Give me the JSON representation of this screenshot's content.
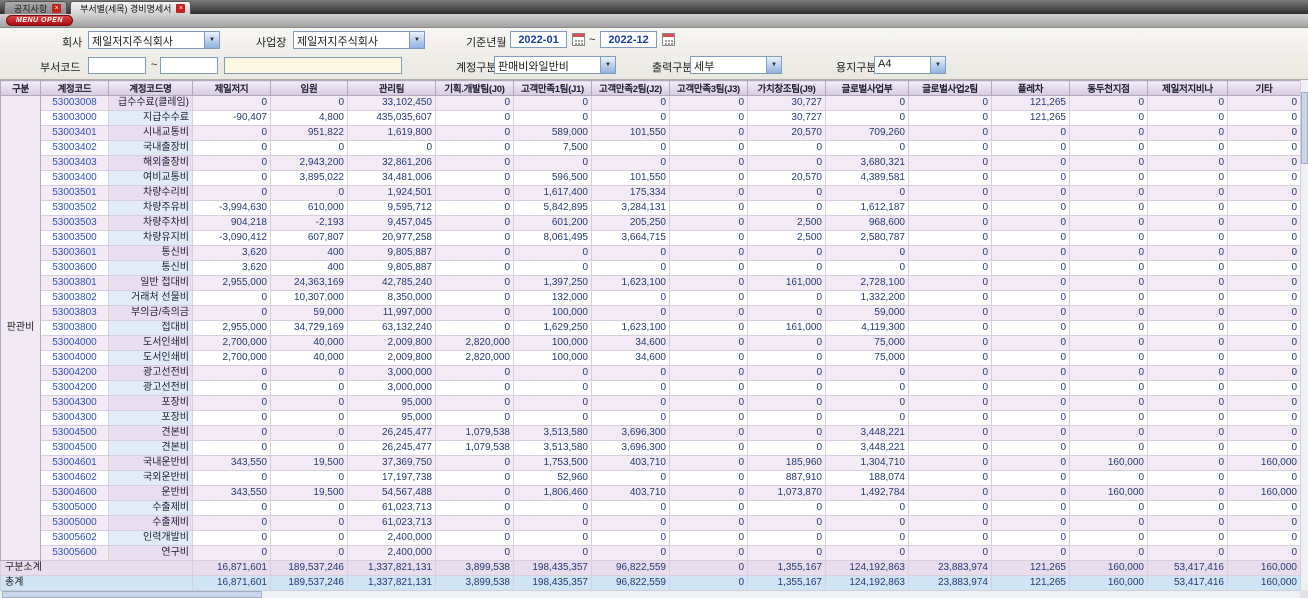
{
  "window": {
    "tabs": [
      {
        "label": "공지사항"
      },
      {
        "label": "부서별(세목) 경비명세서"
      }
    ],
    "menu_open_label": "MENU OPEN"
  },
  "filters": {
    "company_label": "회사",
    "company_value": "제일저지주식회사",
    "site_label": "사업장",
    "site_value": "제일저지주식회사",
    "period_label": "기준년월",
    "period_from": "2022-01",
    "period_to": "2022-12",
    "range_separator": "~",
    "dept_code_label": "부서코드",
    "dept_code_from": "",
    "dept_code_to": "",
    "dept_name": "",
    "account_type_label": "계정구분",
    "account_type_value": "판매비와일반비",
    "output_type_label": "출력구분",
    "output_type_value": "세부",
    "paper_type_label": "용지구분",
    "paper_type_value": "A4"
  },
  "table": {
    "group_label": "판관비",
    "headers": [
      "구분",
      "계정코드",
      "계정코드명",
      "제일저지",
      "임원",
      "관리팀",
      "기획.개발팀(J0)",
      "고객만족1팀(J1)",
      "고객만족2팀(J2)",
      "고객만족3팀(J3)",
      "가치창조팀(J9)",
      "글로벌사업부",
      "글로벌사업2팀",
      "플레차",
      "동두천지점",
      "제일저지비나",
      "기타"
    ],
    "rows": [
      {
        "code": "53003008",
        "name": "급수수료(클레임)",
        "values": [
          "0",
          "0",
          "33,102,450",
          "0",
          "0",
          "0",
          "0",
          "30,727",
          "0",
          "0",
          "121,265",
          "0",
          "0",
          "0"
        ]
      },
      {
        "code": "53003000",
        "name": "지급수수료",
        "values": [
          "-90,407",
          "4,800",
          "435,035,607",
          "0",
          "0",
          "0",
          "0",
          "30,727",
          "0",
          "0",
          "121,265",
          "0",
          "0",
          "0"
        ]
      },
      {
        "code": "53003401",
        "name": "시내교통비",
        "values": [
          "0",
          "951,822",
          "1,619,800",
          "0",
          "589,000",
          "101,550",
          "0",
          "20,570",
          "709,260",
          "0",
          "0",
          "0",
          "0",
          "0"
        ]
      },
      {
        "code": "53003402",
        "name": "국내출장비",
        "values": [
          "0",
          "0",
          "0",
          "0",
          "7,500",
          "0",
          "0",
          "0",
          "0",
          "0",
          "0",
          "0",
          "0",
          "0"
        ]
      },
      {
        "code": "53003403",
        "name": "해외출장비",
        "values": [
          "0",
          "2,943,200",
          "32,861,206",
          "0",
          "0",
          "0",
          "0",
          "0",
          "3,680,321",
          "0",
          "0",
          "0",
          "0",
          "0"
        ]
      },
      {
        "code": "53003400",
        "name": "여비교통비",
        "values": [
          "0",
          "3,895,022",
          "34,481,006",
          "0",
          "596,500",
          "101,550",
          "0",
          "20,570",
          "4,389,581",
          "0",
          "0",
          "0",
          "0",
          "0"
        ]
      },
      {
        "code": "53003501",
        "name": "차량수리비",
        "values": [
          "0",
          "0",
          "1,924,501",
          "0",
          "1,617,400",
          "175,334",
          "0",
          "0",
          "0",
          "0",
          "0",
          "0",
          "0",
          "0"
        ]
      },
      {
        "code": "53003502",
        "name": "차량주유비",
        "values": [
          "-3,994,630",
          "610,000",
          "9,595,712",
          "0",
          "5,842,895",
          "3,284,131",
          "0",
          "0",
          "1,612,187",
          "0",
          "0",
          "0",
          "0",
          "0"
        ]
      },
      {
        "code": "53003503",
        "name": "차량주차비",
        "values": [
          "904,218",
          "-2,193",
          "9,457,045",
          "0",
          "601,200",
          "205,250",
          "0",
          "2,500",
          "968,600",
          "0",
          "0",
          "0",
          "0",
          "0"
        ]
      },
      {
        "code": "53003500",
        "name": "차량유지비",
        "values": [
          "-3,090,412",
          "607,807",
          "20,977,258",
          "0",
          "8,061,495",
          "3,664,715",
          "0",
          "2,500",
          "2,580,787",
          "0",
          "0",
          "0",
          "0",
          "0"
        ]
      },
      {
        "code": "53003601",
        "name": "통신비",
        "values": [
          "3,620",
          "400",
          "9,805,887",
          "0",
          "0",
          "0",
          "0",
          "0",
          "0",
          "0",
          "0",
          "0",
          "0",
          "0"
        ]
      },
      {
        "code": "53003600",
        "name": "통신비",
        "values": [
          "3,620",
          "400",
          "9,805,887",
          "0",
          "0",
          "0",
          "0",
          "0",
          "0",
          "0",
          "0",
          "0",
          "0",
          "0"
        ]
      },
      {
        "code": "53003801",
        "name": "일반 접대비",
        "values": [
          "2,955,000",
          "24,363,169",
          "42,785,240",
          "0",
          "1,397,250",
          "1,623,100",
          "0",
          "161,000",
          "2,728,100",
          "0",
          "0",
          "0",
          "0",
          "0"
        ]
      },
      {
        "code": "53003802",
        "name": "거래처 선물비",
        "values": [
          "0",
          "10,307,000",
          "8,350,000",
          "0",
          "132,000",
          "0",
          "0",
          "0",
          "1,332,200",
          "0",
          "0",
          "0",
          "0",
          "0"
        ]
      },
      {
        "code": "53003803",
        "name": "부의금/축의금",
        "values": [
          "0",
          "59,000",
          "11,997,000",
          "0",
          "100,000",
          "0",
          "0",
          "0",
          "59,000",
          "0",
          "0",
          "0",
          "0",
          "0"
        ]
      },
      {
        "code": "53003800",
        "name": "접대비",
        "values": [
          "2,955,000",
          "34,729,169",
          "63,132,240",
          "0",
          "1,629,250",
          "1,623,100",
          "0",
          "161,000",
          "4,119,300",
          "0",
          "0",
          "0",
          "0",
          "0"
        ]
      },
      {
        "code": "53004000",
        "name": "도서인쇄비",
        "values": [
          "2,700,000",
          "40,000",
          "2,009,800",
          "2,820,000",
          "100,000",
          "34,600",
          "0",
          "0",
          "75,000",
          "0",
          "0",
          "0",
          "0",
          "0"
        ]
      },
      {
        "code": "53004000",
        "name": "도서인쇄비",
        "values": [
          "2,700,000",
          "40,000",
          "2,009,800",
          "2,820,000",
          "100,000",
          "34,600",
          "0",
          "0",
          "75,000",
          "0",
          "0",
          "0",
          "0",
          "0"
        ]
      },
      {
        "code": "53004200",
        "name": "광고선전비",
        "values": [
          "0",
          "0",
          "3,000,000",
          "0",
          "0",
          "0",
          "0",
          "0",
          "0",
          "0",
          "0",
          "0",
          "0",
          "0"
        ]
      },
      {
        "code": "53004200",
        "name": "광고선전비",
        "values": [
          "0",
          "0",
          "3,000,000",
          "0",
          "0",
          "0",
          "0",
          "0",
          "0",
          "0",
          "0",
          "0",
          "0",
          "0"
        ]
      },
      {
        "code": "53004300",
        "name": "포장비",
        "values": [
          "0",
          "0",
          "95,000",
          "0",
          "0",
          "0",
          "0",
          "0",
          "0",
          "0",
          "0",
          "0",
          "0",
          "0"
        ]
      },
      {
        "code": "53004300",
        "name": "포장비",
        "values": [
          "0",
          "0",
          "95,000",
          "0",
          "0",
          "0",
          "0",
          "0",
          "0",
          "0",
          "0",
          "0",
          "0",
          "0"
        ]
      },
      {
        "code": "53004500",
        "name": "견본비",
        "values": [
          "0",
          "0",
          "26,245,477",
          "1,079,538",
          "3,513,580",
          "3,696,300",
          "0",
          "0",
          "3,448,221",
          "0",
          "0",
          "0",
          "0",
          "0"
        ]
      },
      {
        "code": "53004500",
        "name": "견본비",
        "values": [
          "0",
          "0",
          "26,245,477",
          "1,079,538",
          "3,513,580",
          "3,696,300",
          "0",
          "0",
          "3,448,221",
          "0",
          "0",
          "0",
          "0",
          "0"
        ]
      },
      {
        "code": "53004601",
        "name": "국내운반비",
        "values": [
          "343,550",
          "19,500",
          "37,369,750",
          "0",
          "1,753,500",
          "403,710",
          "0",
          "185,960",
          "1,304,710",
          "0",
          "0",
          "160,000",
          "0",
          "160,000"
        ]
      },
      {
        "code": "53004602",
        "name": "국외운반비",
        "values": [
          "0",
          "0",
          "17,197,738",
          "0",
          "52,960",
          "0",
          "0",
          "887,910",
          "188,074",
          "0",
          "0",
          "0",
          "0",
          "0"
        ]
      },
      {
        "code": "53004600",
        "name": "운반비",
        "values": [
          "343,550",
          "19,500",
          "54,567,488",
          "0",
          "1,806,460",
          "403,710",
          "0",
          "1,073,870",
          "1,492,784",
          "0",
          "0",
          "160,000",
          "0",
          "160,000"
        ]
      },
      {
        "code": "53005000",
        "name": "수출제비",
        "values": [
          "0",
          "0",
          "61,023,713",
          "0",
          "0",
          "0",
          "0",
          "0",
          "0",
          "0",
          "0",
          "0",
          "0",
          "0"
        ]
      },
      {
        "code": "53005000",
        "name": "수출제비",
        "values": [
          "0",
          "0",
          "61,023,713",
          "0",
          "0",
          "0",
          "0",
          "0",
          "0",
          "0",
          "0",
          "0",
          "0",
          "0"
        ]
      },
      {
        "code": "53005602",
        "name": "인력개발비",
        "values": [
          "0",
          "0",
          "2,400,000",
          "0",
          "0",
          "0",
          "0",
          "0",
          "0",
          "0",
          "0",
          "0",
          "0",
          "0"
        ]
      },
      {
        "code": "53005600",
        "name": "연구비",
        "values": [
          "0",
          "0",
          "2,400,000",
          "0",
          "0",
          "0",
          "0",
          "0",
          "0",
          "0",
          "0",
          "0",
          "0",
          "0"
        ]
      }
    ],
    "subtotal": {
      "label": "구분소계",
      "values": [
        "16,871,601",
        "189,537,246",
        "1,337,821,131",
        "3,899,538",
        "198,435,357",
        "96,822,559",
        "0",
        "1,355,167",
        "124,192,863",
        "23,883,974",
        "121,265",
        "160,000",
        "53,417,416",
        "160,000"
      ]
    },
    "total": {
      "label": "총계",
      "values": [
        "16,871,601",
        "189,537,246",
        "1,337,821,131",
        "3,899,538",
        "198,435,357",
        "96,822,559",
        "0",
        "1,355,167",
        "124,192,863",
        "23,883,974",
        "121,265",
        "160,000",
        "53,417,416",
        "160,000"
      ]
    }
  }
}
